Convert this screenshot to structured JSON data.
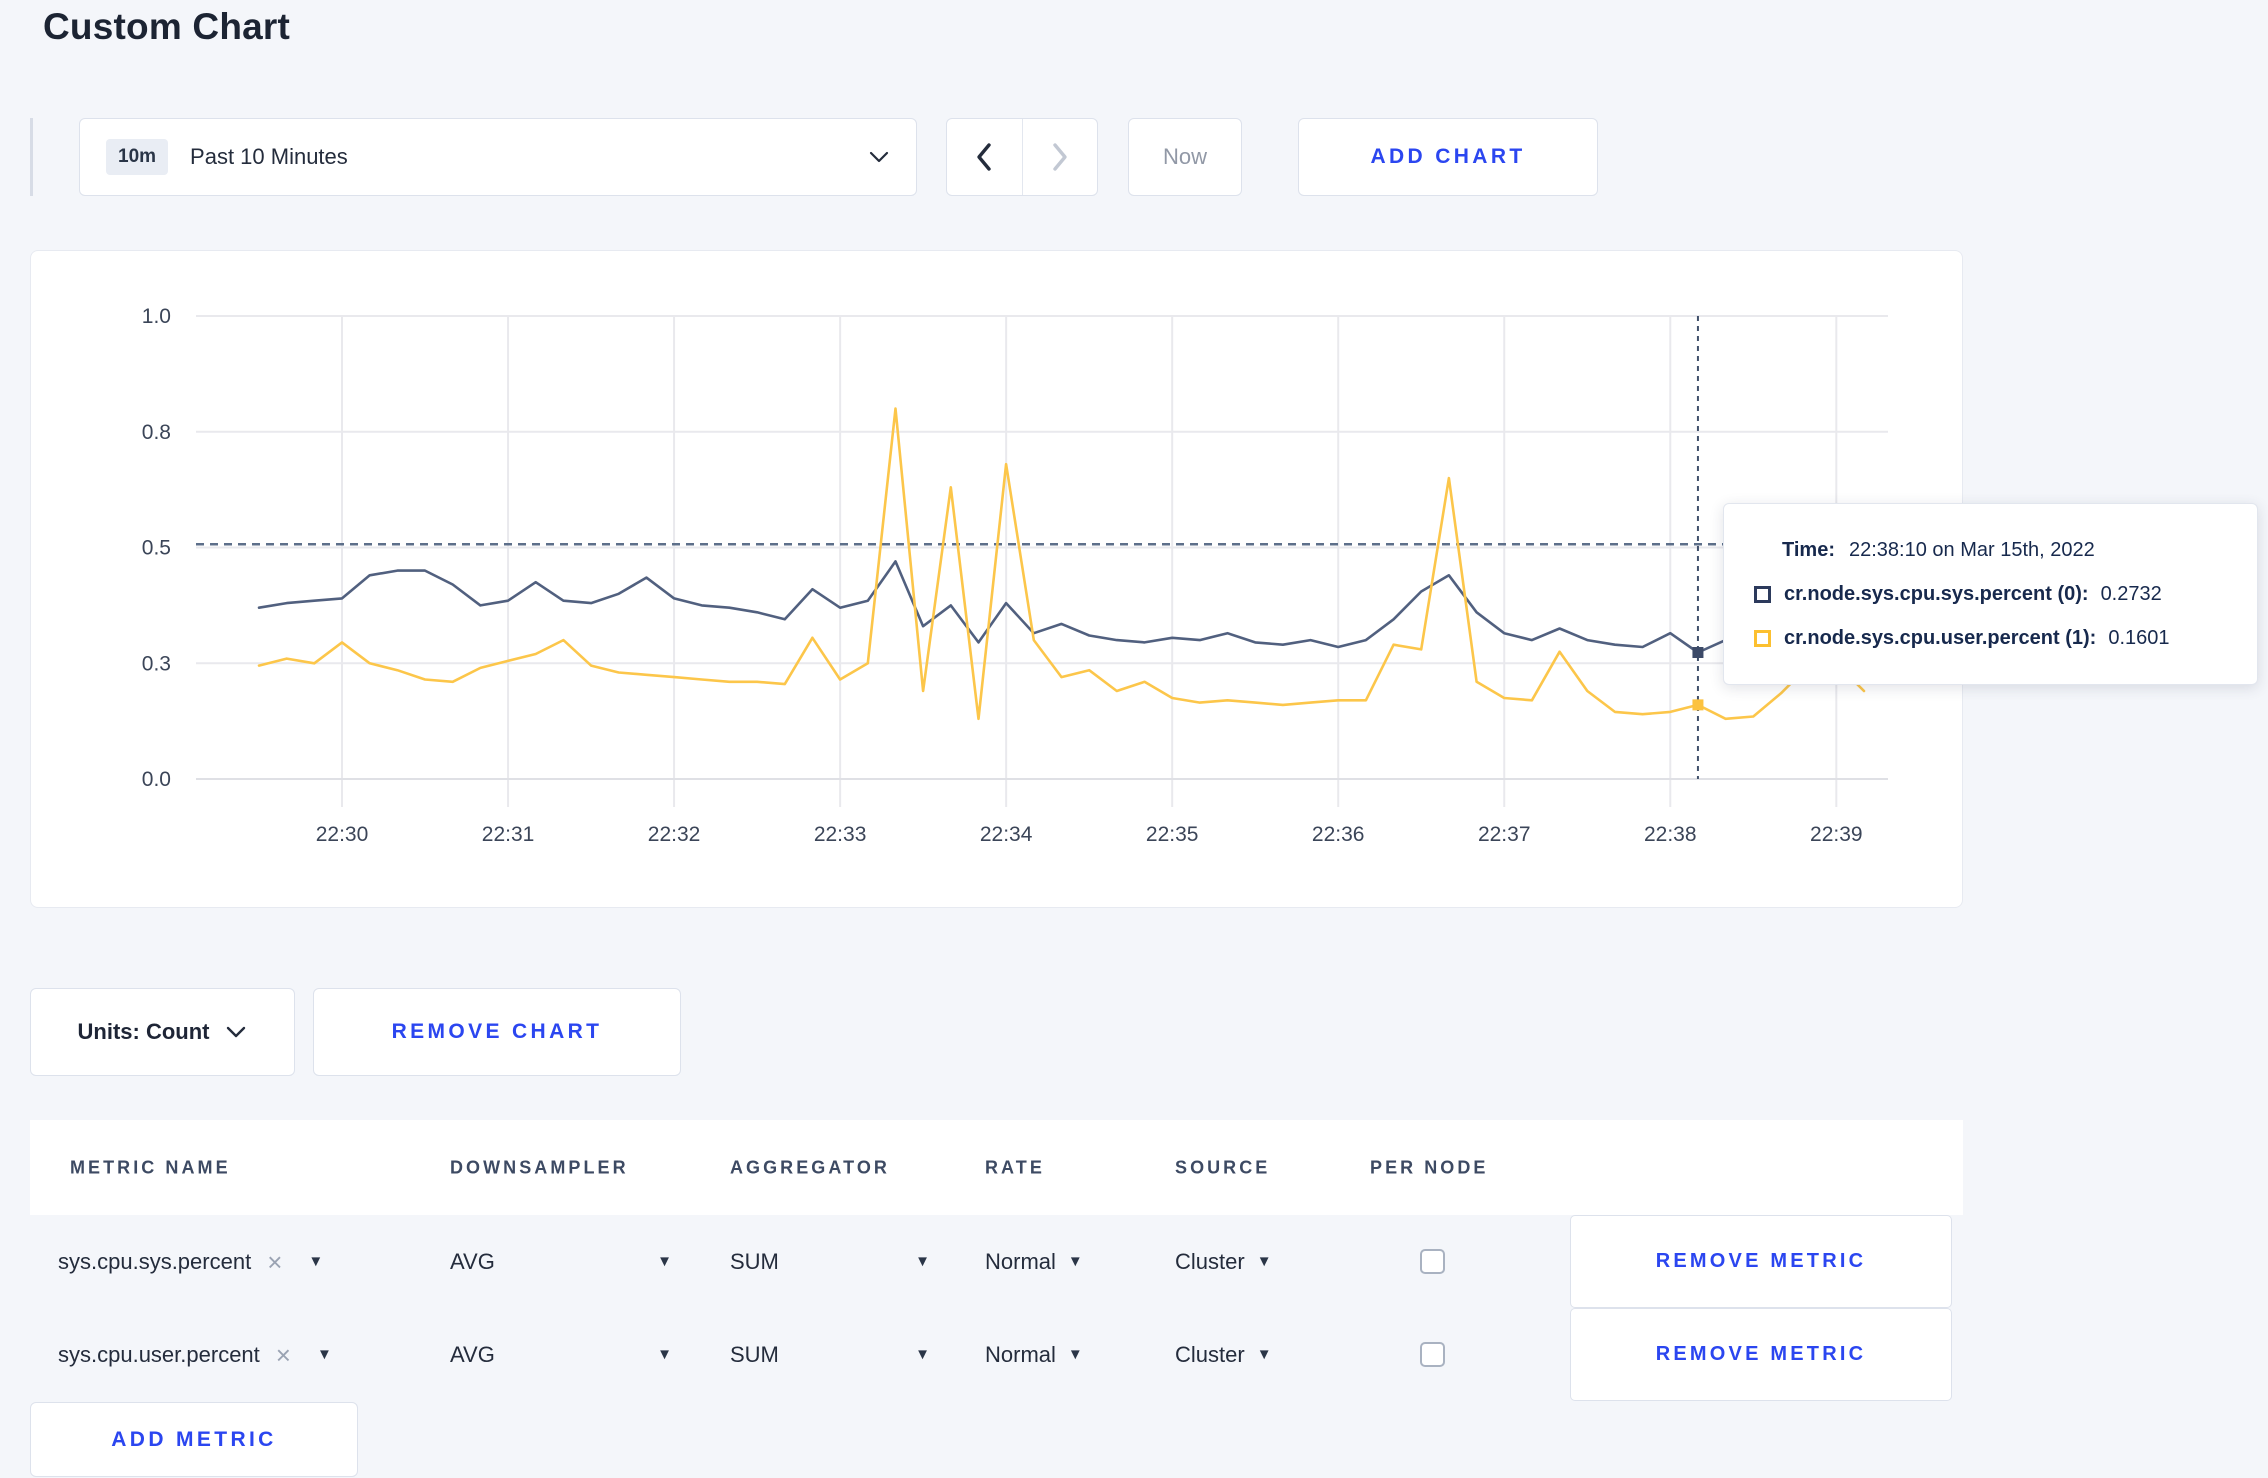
{
  "page": {
    "title": "Custom Chart"
  },
  "colors": {
    "accent_blue": "#2b46f0",
    "series_sys": "#51607f",
    "series_user": "#fcc64a",
    "crosshair": "#41506b",
    "threshold": "#5d6f8a",
    "grid": "#e9e9ed",
    "axis_text": "#3b4558"
  },
  "toolbar": {
    "time_range_badge": "10m",
    "time_range_label": "Past 10 Minutes",
    "now_label": "Now",
    "add_chart_label": "ADD CHART"
  },
  "chart_data": {
    "type": "line",
    "title": "",
    "xlabel": "",
    "ylabel": "",
    "ylim": [
      0,
      1
    ],
    "grid": true,
    "x_tick_labels": [
      "22:30",
      "22:31",
      "22:32",
      "22:33",
      "22:34",
      "22:35",
      "22:36",
      "22:37",
      "22:38",
      "22:39"
    ],
    "y_tick_labels": [
      "0.0",
      "0.3",
      "0.5",
      "0.8",
      "1.0"
    ],
    "y_tick_values": [
      0,
      0.25,
      0.5,
      0.75,
      1.0
    ],
    "x_start": "22:29:30",
    "x_end": "22:39:10",
    "interval_seconds": 10,
    "threshold_dashed_line_value": 0.507,
    "crosshair": {
      "index": 52,
      "time": "22:38:10"
    },
    "series": [
      {
        "name": "cr.node.sys.cpu.sys.percent",
        "color": "#51607f",
        "values": [
          0.37,
          0.38,
          0.385,
          0.39,
          0.44,
          0.45,
          0.45,
          0.42,
          0.375,
          0.385,
          0.425,
          0.385,
          0.38,
          0.4,
          0.435,
          0.39,
          0.375,
          0.37,
          0.36,
          0.345,
          0.41,
          0.37,
          0.385,
          0.47,
          0.33,
          0.375,
          0.295,
          0.38,
          0.315,
          0.335,
          0.31,
          0.3,
          0.295,
          0.305,
          0.3,
          0.315,
          0.295,
          0.29,
          0.3,
          0.285,
          0.3,
          0.345,
          0.405,
          0.44,
          0.36,
          0.315,
          0.3,
          0.325,
          0.3,
          0.29,
          0.285,
          0.315,
          0.2732,
          0.3,
          0.315,
          0.3,
          0.295,
          0.305,
          0.3
        ]
      },
      {
        "name": "cr.node.sys.cpu.user.percent",
        "color": "#fcc64a",
        "values": [
          0.245,
          0.26,
          0.25,
          0.295,
          0.25,
          0.235,
          0.215,
          0.21,
          0.24,
          0.255,
          0.27,
          0.3,
          0.245,
          0.23,
          0.225,
          0.22,
          0.215,
          0.21,
          0.21,
          0.205,
          0.305,
          0.215,
          0.25,
          0.8,
          0.19,
          0.63,
          0.13,
          0.68,
          0.3,
          0.22,
          0.235,
          0.19,
          0.21,
          0.175,
          0.165,
          0.17,
          0.165,
          0.16,
          0.165,
          0.17,
          0.17,
          0.29,
          0.28,
          0.65,
          0.21,
          0.175,
          0.17,
          0.275,
          0.19,
          0.145,
          0.14,
          0.145,
          0.1601,
          0.13,
          0.135,
          0.185,
          0.245,
          0.25,
          0.19
        ]
      }
    ]
  },
  "tooltip": {
    "time_label": "Time:",
    "time_value": "22:38:10 on Mar 15th, 2022",
    "rows": [
      {
        "swatch_color": "#2c3a5c",
        "label": "cr.node.sys.cpu.sys.percent (0):",
        "value": "0.2732"
      },
      {
        "swatch_color": "#fcc030",
        "label": "cr.node.sys.cpu.user.percent (1):",
        "value": "0.1601"
      }
    ]
  },
  "chart_footer": {
    "units_label": "Units: Count",
    "remove_chart_label": "REMOVE CHART"
  },
  "metrics_table": {
    "headers": [
      "METRIC NAME",
      "DOWNSAMPLER",
      "AGGREGATOR",
      "RATE",
      "SOURCE",
      "PER NODE"
    ],
    "rows": [
      {
        "metric": "sys.cpu.sys.percent",
        "downsampler": "AVG",
        "aggregator": "SUM",
        "rate": "Normal",
        "source": "Cluster",
        "per_node_checked": false,
        "remove_label": "REMOVE METRIC"
      },
      {
        "metric": "sys.cpu.user.percent",
        "downsampler": "AVG",
        "aggregator": "SUM",
        "rate": "Normal",
        "source": "Cluster",
        "per_node_checked": false,
        "remove_label": "REMOVE METRIC"
      }
    ],
    "add_metric_label": "ADD METRIC"
  }
}
